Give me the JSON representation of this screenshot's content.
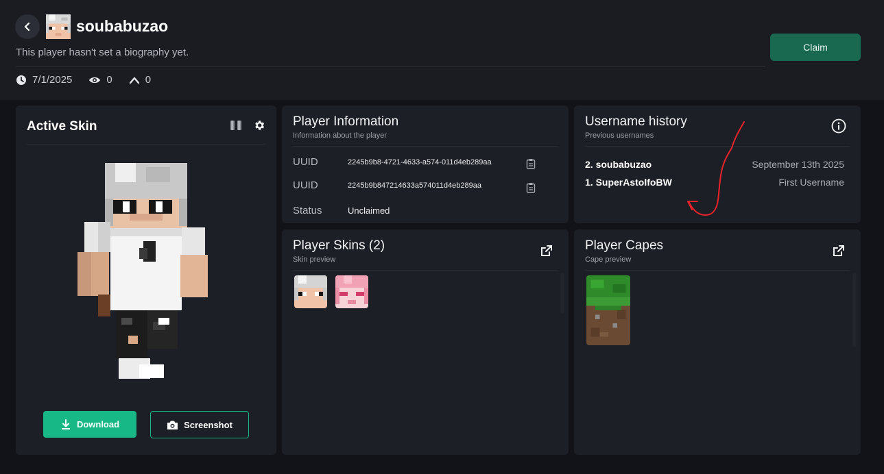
{
  "profile": {
    "username": "soubabuzao",
    "bio": "This player hasn't set a biography yet.",
    "date": "7/1/2025",
    "views": "0",
    "upvotes": "0",
    "claim_label": "Claim"
  },
  "active_skin": {
    "title": "Active Skin",
    "download_label": "Download",
    "screenshot_label": "Screenshot"
  },
  "player_info": {
    "title": "Player Information",
    "subtitle": "Information about the player",
    "rows": [
      {
        "label": "UUID",
        "value": "2245b9b8-4721-4633-a574-011d4eb289aa"
      },
      {
        "label": "UUID",
        "value": "2245b9b847214633a574011d4eb289aa"
      },
      {
        "label": "Status",
        "value": "Unclaimed"
      }
    ]
  },
  "username_history": {
    "title": "Username history",
    "subtitle": "Previous usernames",
    "entries": [
      {
        "name": "2. soubabuzao",
        "date": "September 13th 2025"
      },
      {
        "name": "1. SuperAstolfoBW",
        "date": "First Username"
      }
    ]
  },
  "player_skins": {
    "title": "Player Skins (2)",
    "subtitle": "Skin preview"
  },
  "player_capes": {
    "title": "Player Capes",
    "subtitle": "Cape preview"
  },
  "colors": {
    "accent": "#17b886",
    "claim": "#18694f",
    "annotation": "#e8232a"
  }
}
